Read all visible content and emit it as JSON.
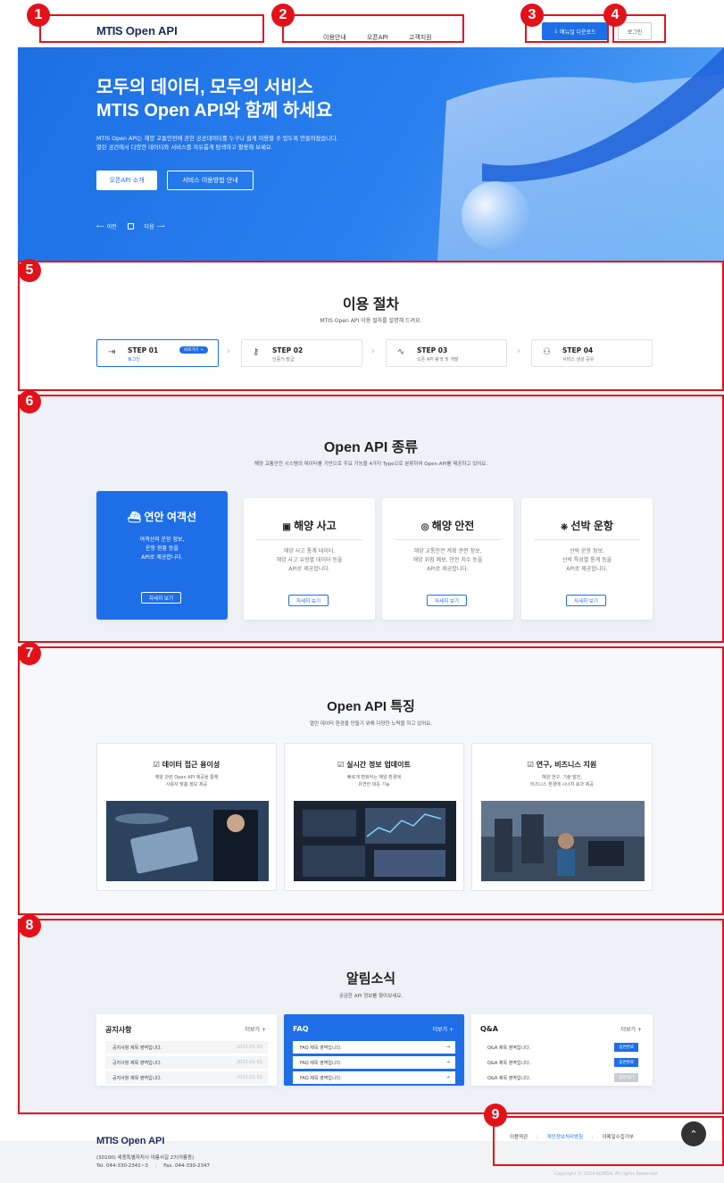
{
  "colors": {
    "accent": "#1e6ee8",
    "marker": "#e3121a",
    "navy": "#1a2b5b",
    "section_bg": "#eef2f7"
  },
  "markers": [
    "1",
    "2",
    "3",
    "4",
    "5",
    "6",
    "7",
    "8",
    "9"
  ],
  "header": {
    "logo_prefix": "MTIS",
    "logo_suffix": "Open API",
    "nav": [
      "이용안내",
      "오픈API",
      "고객지원"
    ],
    "manual_button": "매뉴얼 다운로드",
    "login_button": "로그인"
  },
  "hero": {
    "title_line1": "모두의 데이터, 모두의 서비스",
    "title_line2": "MTIS Open API와 함께 하세요",
    "desc_line1": "MTIS Open API는 해양 교통안전에 관한 공공데이터를 누구나 쉽게 이용할 수 있도록 만들어졌습니다.",
    "desc_line2": "열린 공간에서 다양한 데이터와 서비스를 자유롭게 탐색하고 활용해 보세요.",
    "btn_intro": "오픈API 소개",
    "btn_guide": "서비스 이용방법 안내",
    "prev": "이전",
    "next": "다음"
  },
  "procedure": {
    "title": "이용 절차",
    "subtitle": "MTIS Open API 이용 절차를 설명해 드려요.",
    "steps": [
      {
        "label": "STEP 01",
        "desc": "로그인",
        "icon": "login-icon",
        "badge": "바로가기 →"
      },
      {
        "label": "STEP 02",
        "desc": "인증키 발급",
        "icon": "key-icon"
      },
      {
        "label": "STEP 03",
        "desc": "오픈 API 탐색 및 개발",
        "icon": "activity-icon"
      },
      {
        "label": "STEP 04",
        "desc": "서비스 생성 공유",
        "icon": "users-icon"
      }
    ]
  },
  "types": {
    "title": "Open API 종류",
    "subtitle": "해양 교통안전 시스템의 데이터를 기반으로 주요 기능을 4가지 Type으로 분류하여 Open API를 제공하고 있어요.",
    "cards": [
      {
        "title": "연안 여객선",
        "desc": "여객선의 운항 정보,\n운항 현황 등을\nAPI로 제공합니다.",
        "button": "자세히 보기",
        "icon": "ship-icon"
      },
      {
        "title": "해양 사고",
        "desc": "해양 사고 통계 데이터,\n해양 사고 유형별 데이터 등을\nAPI로 제공합니다.",
        "button": "자세히 보기",
        "icon": "document-icon"
      },
      {
        "title": "해양 안전",
        "desc": "해양 교통안전 계획 관련 정보,\n해양 위험 예보, 안전 지수 등을\nAPI로 제공합니다.",
        "button": "자세히 보기",
        "icon": "shield-check-icon"
      },
      {
        "title": "선박 운항",
        "desc": "선박 운항 정보,\n선박 특성별 통계 등을\nAPI로 제공합니다.",
        "button": "자세히 보기",
        "icon": "helm-icon"
      }
    ]
  },
  "features": {
    "title": "Open API 특징",
    "subtitle": "열린 데이터 환경을 만들기 위해 다양한 노력을 하고 있어요.",
    "items": [
      {
        "title": "데이터 접근 용이성",
        "desc": "해양 관련 Open API 제공을 통해\n사용자 맞춤 정보 제공"
      },
      {
        "title": "실시간 정보 업데이트",
        "desc": "빠르게 변화하는 해양 환경에\n유연한 대응 기능"
      },
      {
        "title": "연구, 비즈니스 지원",
        "desc": "해양 연구, 기술 발전,\n비즈니스 환경에 시너지 효과 제공"
      }
    ]
  },
  "news": {
    "title": "알림소식",
    "subtitle": "궁금한 API 정보를 찾아보세요.",
    "more": "더보기 +",
    "notice": {
      "title": "공지사항",
      "rows": [
        {
          "text": "공지사항 제목 영역입니다.",
          "date": "2025-01-01"
        },
        {
          "text": "공지사항 제목 영역입니다.",
          "date": "2025-01-01"
        },
        {
          "text": "공지사항 제목 영역입니다.",
          "date": "2025-01-01"
        }
      ]
    },
    "faq": {
      "title": "FAQ",
      "rows": [
        "FAQ 제목 영역입니다.",
        "FAQ 제목 영역입니다.",
        "FAQ 제목 영역입니다."
      ],
      "arrow": "→"
    },
    "qna": {
      "title": "Q&A",
      "rows": [
        {
          "text": "Q&A 제목 영역입니다.",
          "status": "답변완료"
        },
        {
          "text": "Q&A 제목 영역입니다.",
          "status": "답변완료"
        },
        {
          "text": "Q&A 제목 영역입니다.",
          "status": "답변대기"
        }
      ]
    }
  },
  "footer": {
    "logo_prefix": "MTIS",
    "logo_suffix": "Open API",
    "address": "(30100) 세종특별자치시 아름서길 27(어룡동)",
    "tel": "Tel. 044-330-2341~3",
    "fax": "Fax. 044-330-2347",
    "links": [
      "이용약관",
      "개인정보처리방침",
      "이메일수집거부"
    ],
    "copyright": "Copyright © 2024 KOMSA. All rights Reserved."
  }
}
